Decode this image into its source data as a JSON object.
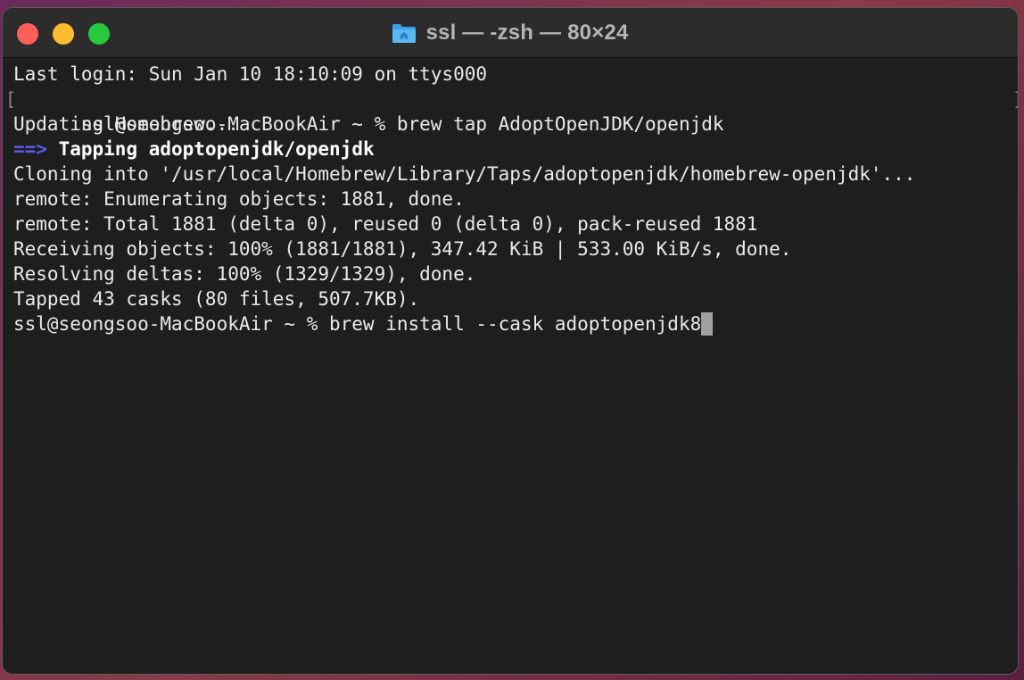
{
  "window": {
    "title": "ssl — -zsh — 80×24"
  },
  "terminal": {
    "line1": "Last login: Sun Jan 10 18:10:09 on ttys000",
    "line2": "ssl@seongsoo-MacBookAir ~ % brew tap AdoptOpenJDK/openjdk",
    "line3": "Updating Homebrew...",
    "line4_arrow": "==>",
    "line4_text": "Tapping adoptopenjdk/openjdk",
    "line5": "Cloning into '/usr/local/Homebrew/Library/Taps/adoptopenjdk/homebrew-openjdk'...",
    "line6": "remote: Enumerating objects: 1881, done.",
    "line7": "remote: Total 1881 (delta 0), reused 0 (delta 0), pack-reused 1881",
    "line8": "Receiving objects: 100% (1881/1881), 347.42 KiB | 533.00 KiB/s, done.",
    "line9": "Resolving deltas: 100% (1329/1329), done.",
    "line10": "Tapped 43 casks (80 files, 507.7KB).",
    "line11": "ssl@seongsoo-MacBookAir ~ % brew install --cask adoptopenjdk8",
    "mark_left": "[",
    "mark_right": "]"
  },
  "colors": {
    "arrow": "#5a5af0",
    "close": "#fe5f57",
    "minimize": "#febc2e",
    "zoom": "#28c840"
  }
}
